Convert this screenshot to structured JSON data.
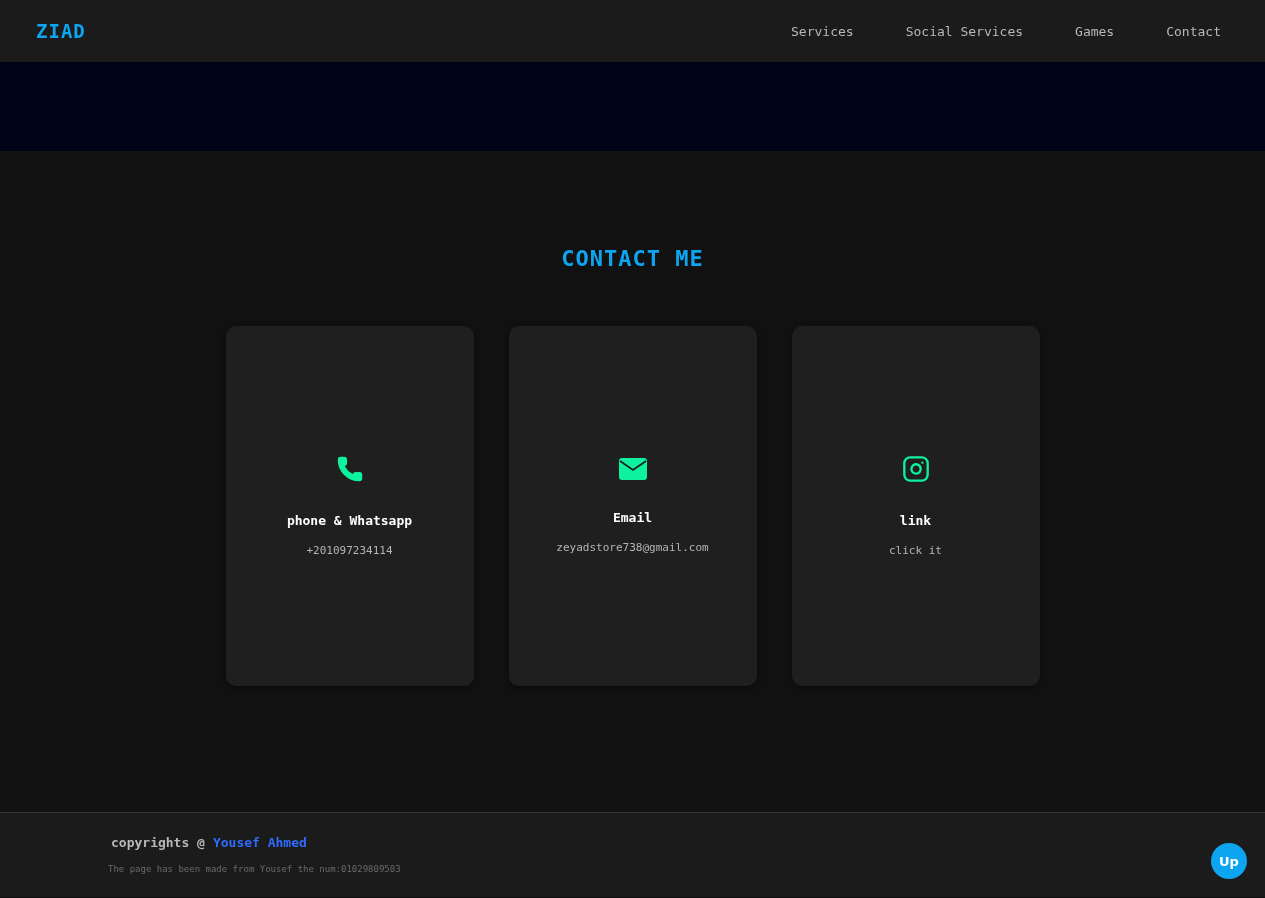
{
  "header": {
    "logo": "ZIAD",
    "nav": [
      {
        "label": "Services"
      },
      {
        "label": "Social Services"
      },
      {
        "label": "Games"
      },
      {
        "label": "Contact"
      }
    ]
  },
  "contact": {
    "title": "CONTACT ME",
    "cards": [
      {
        "kind": "phone",
        "title": "phone & Whatsapp",
        "value": "+201097234114"
      },
      {
        "kind": "email",
        "title": "Email",
        "value": "zeyadstore738@gmail.com"
      },
      {
        "kind": "instagram",
        "title": "link",
        "value": "click it"
      }
    ]
  },
  "footer": {
    "copyright": "copyrights @",
    "author": "Yousef Ahmed",
    "note": "The page has been made from Yousef the num:01029809503",
    "up_button": "Up"
  }
}
